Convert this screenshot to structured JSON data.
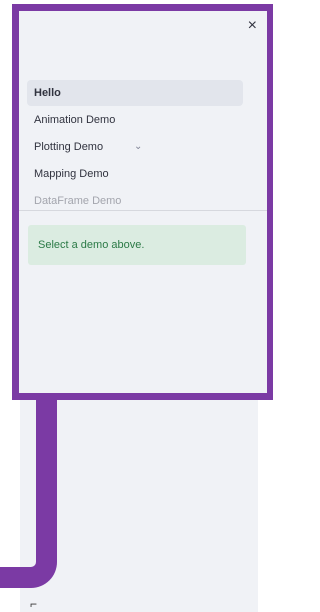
{
  "sidebar": {
    "close_icon": "×",
    "items": [
      {
        "label": "Hello",
        "active": true
      },
      {
        "label": "Animation Demo"
      },
      {
        "label": "Plotting Demo"
      },
      {
        "label": "Mapping Demo"
      },
      {
        "label": "DataFrame Demo"
      }
    ],
    "expand_icon": "⌄"
  },
  "message": {
    "text": "Select a demo above."
  },
  "colors": {
    "frame_accent": "#7b3aa4",
    "panel_bg": "#f0f2f6",
    "active_item_bg": "#e2e5ec",
    "success_bg": "#dbece1",
    "success_text": "#2b7a46"
  }
}
